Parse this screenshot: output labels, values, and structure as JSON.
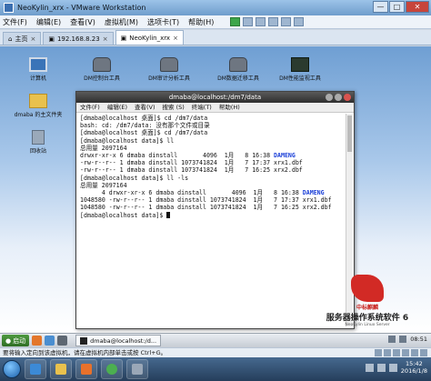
{
  "window": {
    "title": "NeoKylin_xrx - VMware Workstation",
    "buttons": [
      "—",
      "□",
      "✕"
    ]
  },
  "menu": [
    "文件(F)",
    "编辑(E)",
    "查看(V)",
    "虚拟机(M)",
    "选项卡(T)",
    "帮助(H)"
  ],
  "tabs": [
    {
      "label": "主页",
      "active": false
    },
    {
      "label": "192.168.8.23",
      "active": false
    },
    {
      "label": "NeoKylin_xrx",
      "active": true
    }
  ],
  "desktop_icons": [
    {
      "label": "计算机",
      "icon": "monitor-icon"
    },
    {
      "label": "dmaba 的主文件夹",
      "icon": "folder-icon"
    },
    {
      "label": "回收站",
      "icon": "trash-icon"
    },
    {
      "label": "DM控制台工具",
      "icon": "database-icon"
    },
    {
      "label": "DM审计分析工具",
      "icon": "database-icon"
    },
    {
      "label": "DM数据迁移工具",
      "icon": "database-icon"
    },
    {
      "label": "DM性能监视工具",
      "icon": "chart-icon"
    }
  ],
  "terminal": {
    "title": "dmaba@localhost:/dm7/data",
    "menu": [
      "文件(F)",
      "编辑(E)",
      "查看(V)",
      "搜索 (S)",
      "终端(T)",
      "帮助(H)"
    ],
    "lines": [
      {
        "text": "[dmaba@localhost 桌面]$ cd /dm7/data"
      },
      {
        "text": "bash: cd: /dm7/data: 没有那个文件或目录"
      },
      {
        "text": "[dmaba@localhost 桌面]$ cd /dm7/data"
      },
      {
        "text": "[dmaba@localhost data]$ ll"
      },
      {
        "text": "总用量 2097164"
      },
      {
        "text": "drwxr-xr-x 6 dmaba dinstall       4096  1月   8 16:38 ",
        "highlight": "DAMENG"
      },
      {
        "text": "-rw-r--r-- 1 dmaba dinstall 1073741824  1月   7 17:37 xrx1.dbf"
      },
      {
        "text": "-rw-r--r-- 1 dmaba dinstall 1073741824  1月   7 16:25 xrx2.dbf"
      },
      {
        "text": "[dmaba@localhost data]$ ll -ls"
      },
      {
        "text": "总用量 2097164"
      },
      {
        "text": "      4 drwxr-xr-x 6 dmaba dinstall       4096  1月   8 16:38 ",
        "highlight": "DAMENG"
      },
      {
        "text": "1048580 -rw-r--r-- 1 dmaba dinstall 1073741824  1月   7 17:37 xrx1.dbf"
      },
      {
        "text": "1048580 -rw-r--r-- 1 dmaba dinstall 1073741824  1月   7 16:25 xrx2.dbf"
      },
      {
        "text": "[dmaba@localhost data]$ ",
        "cursor": true
      }
    ]
  },
  "logo": {
    "brand": "中标麒麟",
    "product": "服务器操作系统软件 6",
    "tagline": "NeoKylin Linux Server"
  },
  "guest_taskbar": {
    "start_label": "启动",
    "task": "dmaba@localhost:/d...",
    "time": "08:51"
  },
  "status_bar": "要将输入定向到该虚拟机，请在虚拟机内部单击或按 Ctrl+G。",
  "host_clock": {
    "time": "15:42",
    "date": "2016/1/8"
  }
}
